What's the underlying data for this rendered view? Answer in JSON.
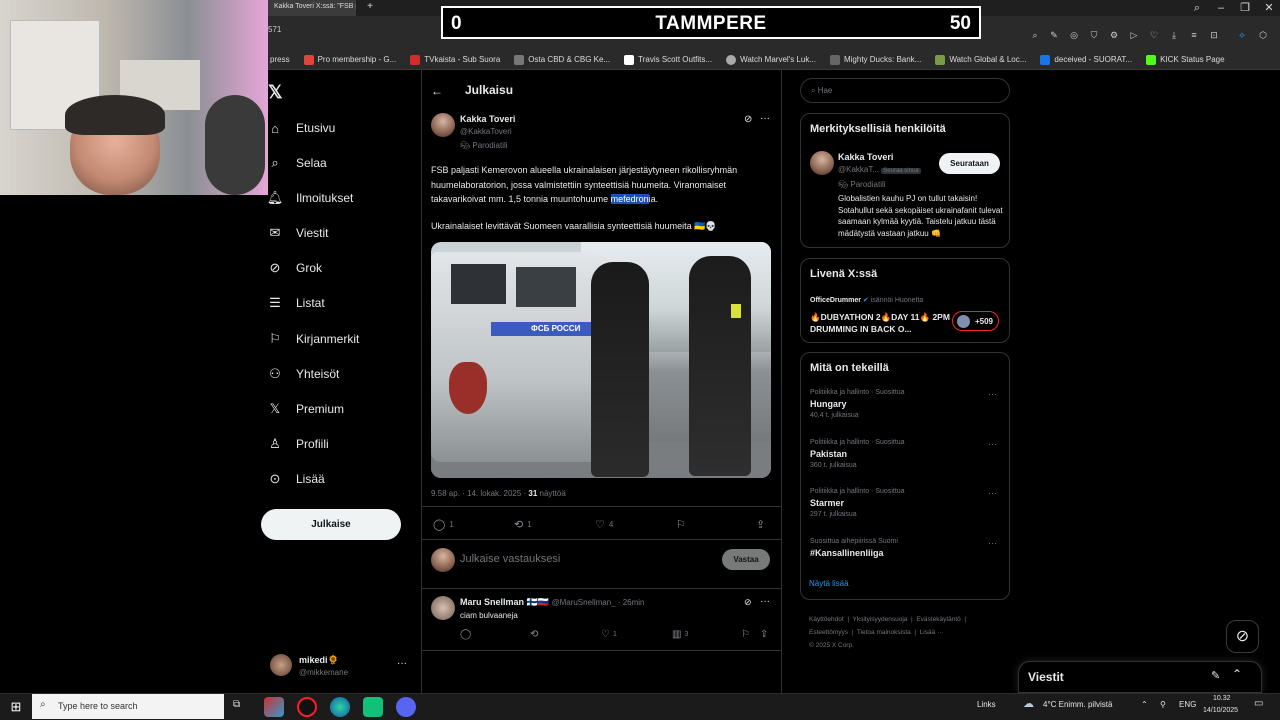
{
  "browser": {
    "tab_title": "Kakka Toveri X:ssä: \"FSB p",
    "address_fragment": "571",
    "bookmarks": [
      "press",
      "Pro membership - G...",
      "TVkaista - Sub Suora",
      "Osta CBD & CBG Ke...",
      "Travis Scott Outfits...",
      "Watch Marvel's Luk...",
      "Mighty Ducks: Bank...",
      "Watch Global & Loc...",
      "deceived - SUORAT...",
      "KICK Status Page"
    ]
  },
  "scoreboard": {
    "left": "0",
    "center": "TAMMPERE",
    "right": "50"
  },
  "nav": {
    "items": [
      "Etusivu",
      "Selaa",
      "Ilmoitukset",
      "Viestit",
      "Grok",
      "Listat",
      "Kirjanmerkit",
      "Yhteisöt",
      "Premium",
      "Profiili",
      "Lisää"
    ],
    "post_button": "Julkaise",
    "me_name": "mikedi🌻",
    "me_handle": "@mikkemane"
  },
  "post": {
    "header": "Julkaisu",
    "author_name": "Kakka Toveri",
    "author_handle": "@KakkaToveri",
    "parody_label": "Parodiatili",
    "text_before": "FSB paljasti Kemerovon alueella ukrainalaisen järjestäytyneen rikollisryhmän huumelaboratorion, jossa valmistettiin synteettisiä huumeita. Viranomaiset takavarikoivat mm. 1,5 tonnia muuntohuume ",
    "text_highlight": "mefedron",
    "text_after": "ia.",
    "text2": "Ukrainalaiset levittävät Suomeen vaarallisia synteettisiä huumeita 🇺🇦💀",
    "image_van_text": "ФСБ РОССИ",
    "timestamp": "9.58 ap. · 14. lokak. 2025 · ",
    "views_count": "31",
    "views_label": " näyttöä",
    "replies": "1",
    "reposts": "1",
    "likes": "4",
    "reply_placeholder": "Julkaise vastauksesi",
    "reply_button": "Vastaa"
  },
  "reply": {
    "author_name": "Maru Snellman 🇫🇮🇷🇺",
    "author_handle": "@MaruSnellman_ · 26min",
    "text": "ciam bulvaaneja",
    "replies": "",
    "reposts": "",
    "likes": "1",
    "views": "3"
  },
  "right": {
    "search_placeholder": "Hae",
    "relevant_title": "Merkityksellisiä henkilöitä",
    "rel_name": "Kakka Toveri",
    "rel_handle": "@KakkaT...",
    "rel_follows_you": "Seuraa sinua",
    "rel_parody": "Parodiatili",
    "follow_button": "Seurataan",
    "rel_bio": "Globalistien kauhu PJ on tullut takaisin! Sotahullut sekä sekopäiset ukrainafanit tulevat saamaan kylmää kyytiä. Taistelu jatkuu tästä mädätystä vastaan jatkuu 👊",
    "live_title": "Livenä X:ssä",
    "live_host": "OfficeDrummer",
    "live_action": "isännöi Huonetta",
    "live_text": "🔥DUBYATHON 2🔥DAY 11🔥 2PM DRUMMING IN BACK O...",
    "live_count": "+509",
    "trends_title": "Mitä on tekeillä",
    "trends": [
      {
        "category": "Politiikka ja hallinto · Suosittua",
        "name": "Hungary",
        "count": "40,4 t. julkaisua"
      },
      {
        "category": "Politiikka ja hallinto · Suosittua",
        "name": "Pakistan",
        "count": "360 t. julkaisua"
      },
      {
        "category": "Politiikka ja hallinto · Suosittua",
        "name": "Starmer",
        "count": "297 t. julkaisua"
      },
      {
        "category": "Suosittua aihepiirissä Suomi",
        "name": "#Kansallinenliiga",
        "count": ""
      }
    ],
    "show_more": "Näytä lisää",
    "footer": [
      "Käyttöehdot",
      "Yksityisyydensuoja",
      "Evästekäytäntö",
      "Esteettömyys",
      "Tietoa mainoksista",
      "Lisää ···",
      "© 2025 X Corp."
    ]
  },
  "messages": {
    "title": "Viestit"
  },
  "taskbar": {
    "search_placeholder": "Type here to search",
    "links": "Links",
    "weather": "4°C  Enimm. pilvistä",
    "lang": "ENG",
    "time": "10.32",
    "date": "14/10/2025"
  }
}
